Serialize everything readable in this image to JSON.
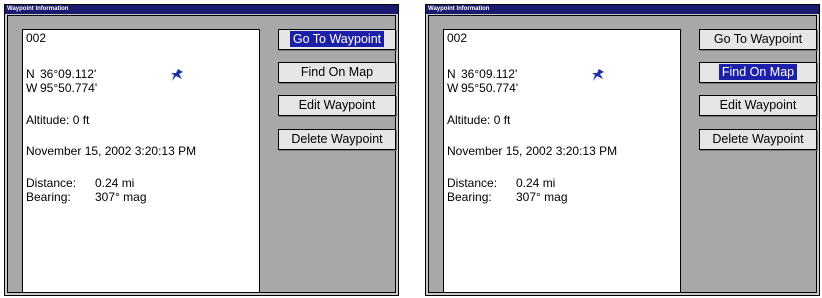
{
  "screens": [
    {
      "title": "Waypoint Information",
      "waypoint_name": "002",
      "lat_hemi": "N",
      "lat_value": "36°09.112'",
      "lon_hemi": "W",
      "lon_value": "95°50.774'",
      "altitude": "Altitude: 0 ft",
      "datetime": "November 15, 2002 3:20:13 PM",
      "distance_label": "Distance:",
      "distance_value": "0.24 mi",
      "bearing_label": "Bearing:",
      "bearing_value": "307° mag",
      "buttons": {
        "go_to": "Go To Waypoint",
        "find_on_map": "Find On Map",
        "edit": "Edit Waypoint",
        "delete": "Delete Waypoint"
      },
      "selected_button": "go_to"
    },
    {
      "title": "Waypoint Information",
      "waypoint_name": "002",
      "lat_hemi": "N",
      "lat_value": "36°09.112'",
      "lon_hemi": "W",
      "lon_value": "95°50.774'",
      "altitude": "Altitude: 0 ft",
      "datetime": "November 15, 2002 3:20:13 PM",
      "distance_label": "Distance:",
      "distance_value": "0.24 mi",
      "bearing_label": "Bearing:",
      "bearing_value": "307° mag",
      "buttons": {
        "go_to": "Go To Waypoint",
        "find_on_map": "Find On Map",
        "edit": "Edit Waypoint",
        "delete": "Delete Waypoint"
      },
      "selected_button": "find_on_map"
    }
  ],
  "colors": {
    "titlebar": "#1a1a6e",
    "selection": "#1c20a8",
    "icon": "#1a2fa8"
  },
  "icons": [
    "waypoint-symbol-icon"
  ]
}
